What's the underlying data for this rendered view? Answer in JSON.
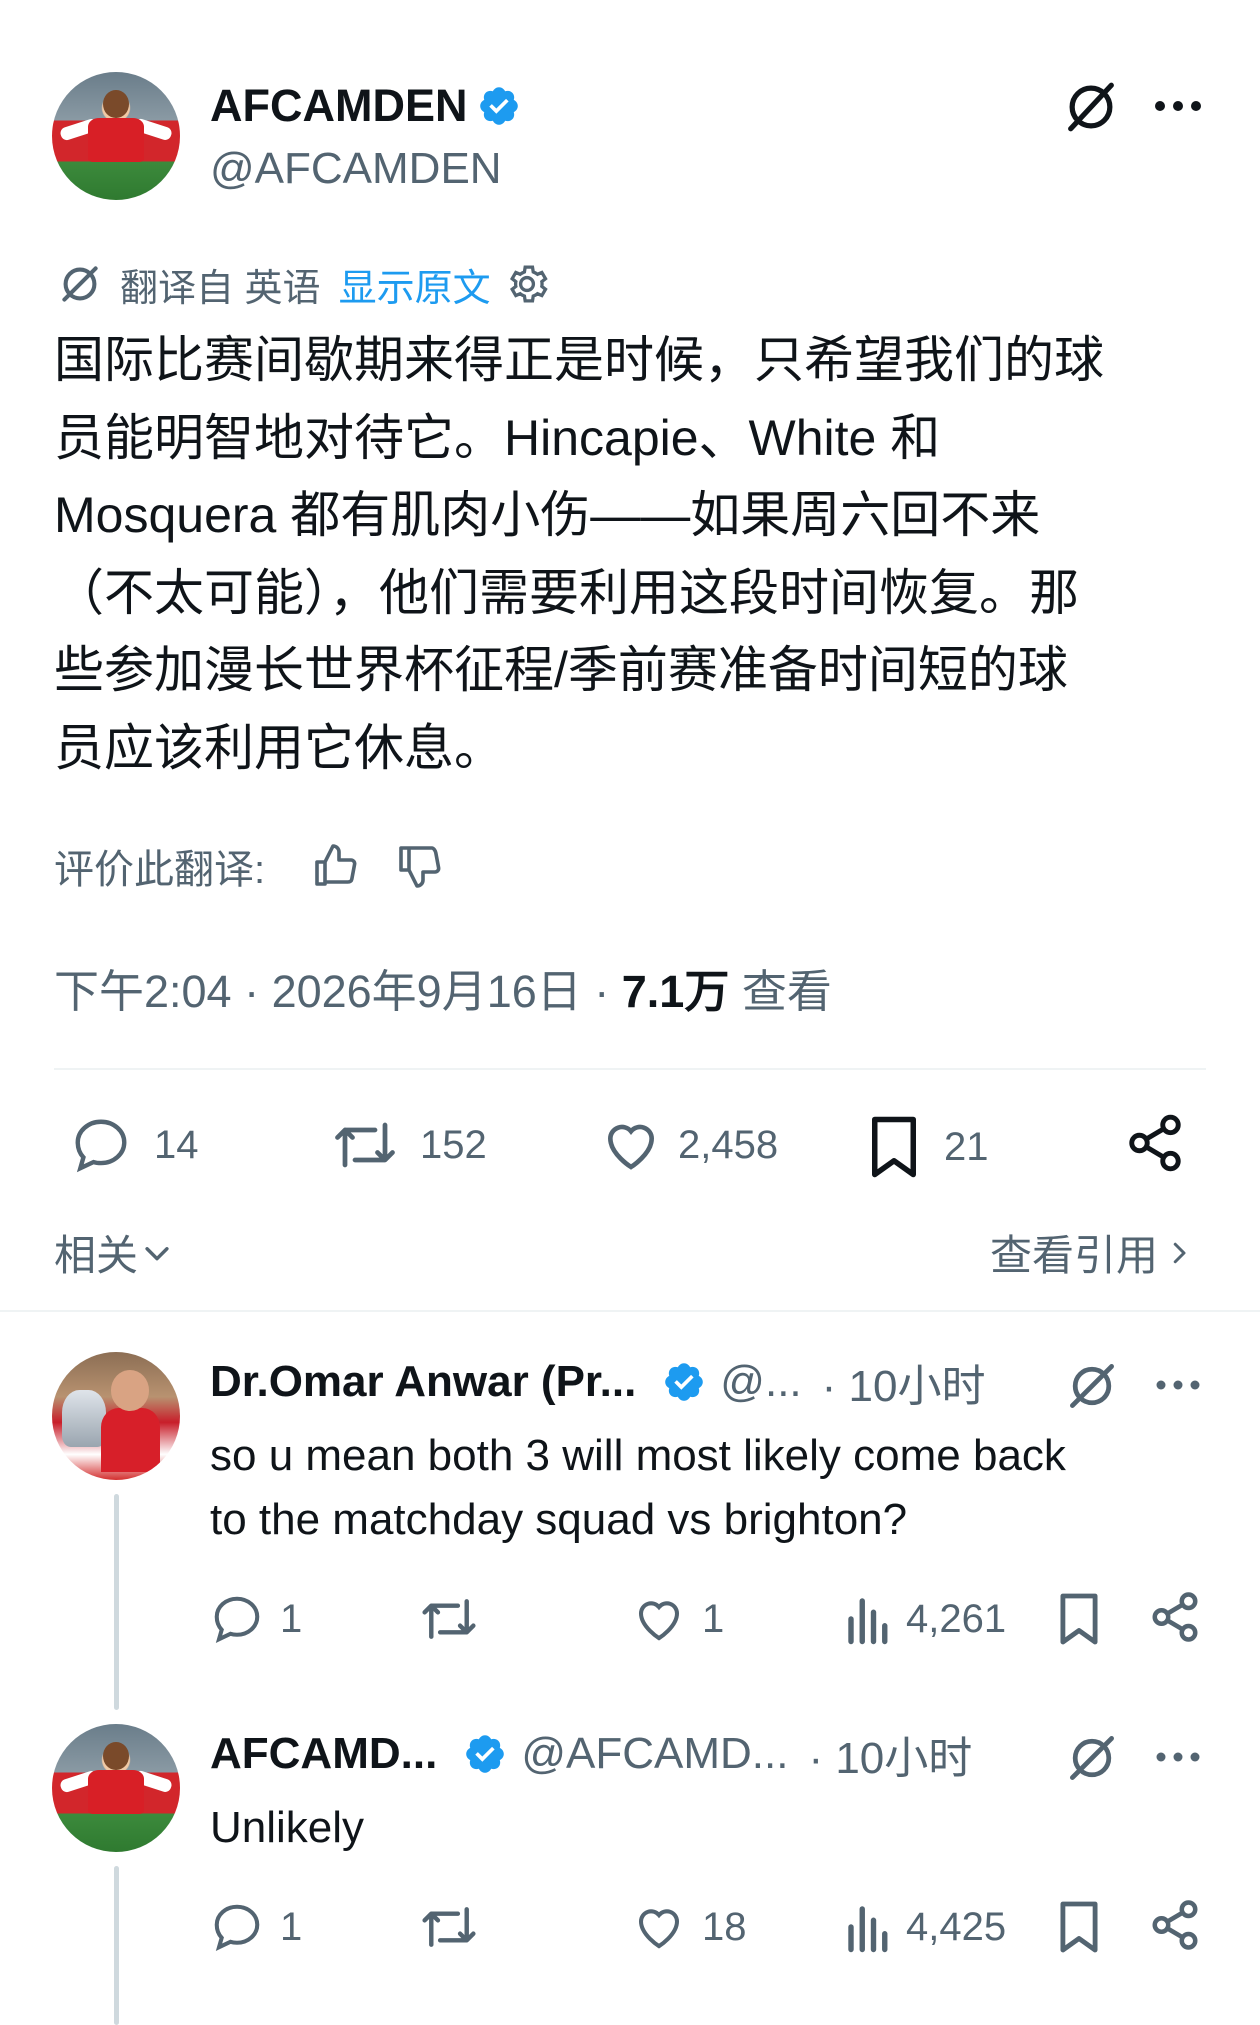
{
  "main_tweet": {
    "author_name": "AFCAMDEN",
    "author_handle": "@AFCAMDEN",
    "translation_bar": {
      "label": "翻译自 英语",
      "show_original": "显示原文"
    },
    "text_lines": [
      "国际比赛间歇期来得正是时候，只希望我们的球",
      "员能明智地对待它。Hincapie、White 和",
      "Mosquera 都有肌肉小伤——如果周六回不来",
      "（不太可能），他们需要利用这段时间恢复。那",
      "些参加漫长世界杯征程/季前赛准备时间短的球",
      "员应该利用它休息。"
    ],
    "rate_translation_label": "评价此翻译:",
    "timestamp": "下午2:04 · 2026年9月16日 · ",
    "views_count": "7.1万",
    "views_label": " 查看",
    "stats": {
      "replies": "14",
      "reposts": "152",
      "likes": "2,458",
      "bookmarks": "21"
    },
    "related_label": "相关",
    "view_quotes_label": "查看引用"
  },
  "replies": [
    {
      "author_name": "Dr.Omar Anwar (Pr...",
      "author_handle": "@...",
      "time": "· 10小时",
      "text_lines": [
        "so u mean both 3 will most likely come back",
        "to the matchday squad vs brighton?"
      ],
      "stats": {
        "replies": "1",
        "reposts": "",
        "likes": "1",
        "views": "4,261"
      }
    },
    {
      "author_name": "AFCAMD...",
      "author_handle": "@AFCAMD...",
      "time": "· 10小时",
      "text_lines": [
        "Unlikely"
      ],
      "stats": {
        "replies": "1",
        "reposts": "",
        "likes": "18",
        "views": "4,425"
      }
    }
  ],
  "colors": {
    "accent": "#1d9bf0",
    "secondary_text": "#536471",
    "primary_text": "#0f1419",
    "divider": "#eff3f4"
  },
  "icons": [
    "verified-badge-icon",
    "grok-icon",
    "more-icon",
    "settings-icon",
    "thumbs-up-icon",
    "thumbs-down-icon",
    "reply-icon",
    "repost-icon",
    "like-icon",
    "bookmark-icon",
    "share-icon",
    "views-icon",
    "chevron-down-icon",
    "chevron-right-icon"
  ]
}
